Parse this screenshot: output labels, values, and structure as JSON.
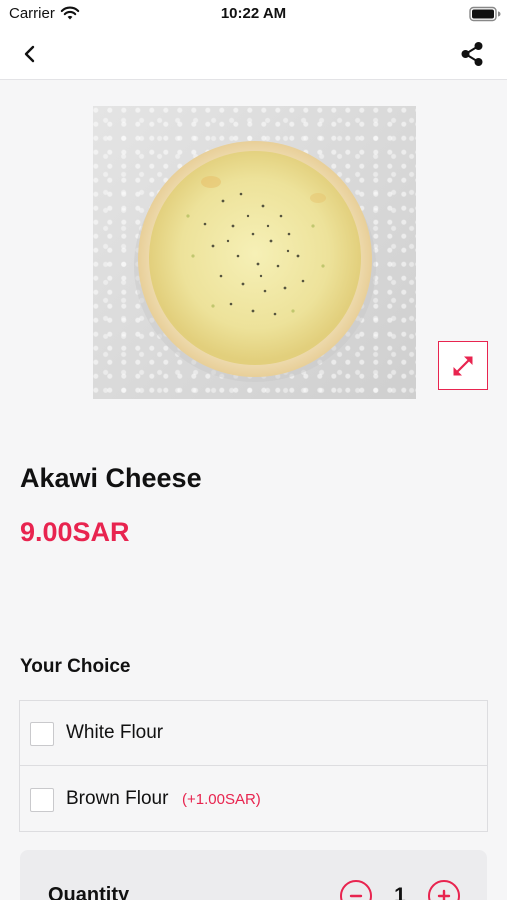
{
  "status_bar": {
    "carrier": "Carrier",
    "time": "10:22 AM",
    "icons": [
      "wifi-icon",
      "battery-icon"
    ]
  },
  "nav_bar": {
    "icons": [
      "chevron-left-icon",
      "share-icon"
    ]
  },
  "product": {
    "image": "pizza-photo",
    "title": "Akawi Cheese",
    "price": "9.00SAR",
    "expand_icon": "expand-arrows-icon"
  },
  "choices": {
    "heading": "Your Choice",
    "options": [
      {
        "label": "White Flour",
        "extra": "",
        "checked": false
      },
      {
        "label": "Brown Flour",
        "extra": "(+1.00SAR)",
        "checked": false
      }
    ]
  },
  "quantity": {
    "label": "Quantity",
    "value": "1",
    "icons": [
      "minus-circle-icon",
      "plus-circle-icon"
    ]
  },
  "colors": {
    "accent": "#e8244f",
    "background": "#f6f6f7",
    "surface": "#ffffff",
    "text": "#111111"
  }
}
